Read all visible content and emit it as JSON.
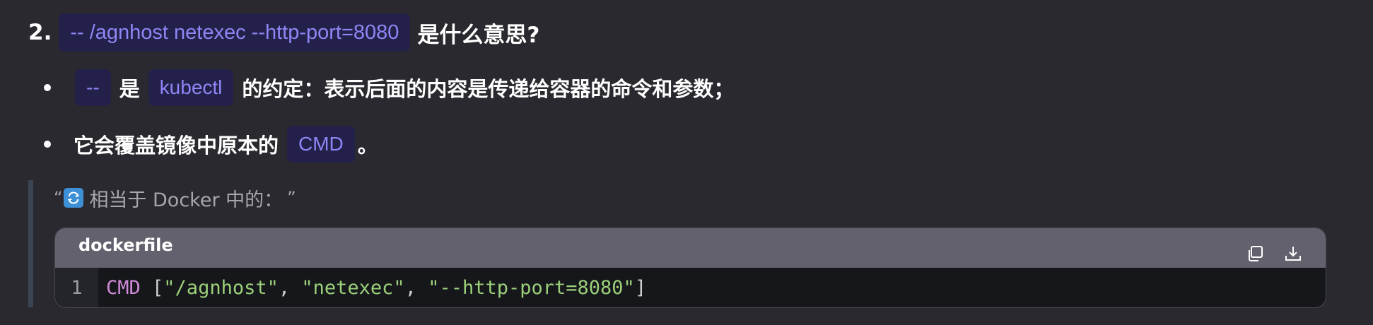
{
  "heading": {
    "number": "2.",
    "code": "-- /agnhost netexec --http-port=8080",
    "tail": "是什么意思?"
  },
  "bullets": [
    {
      "chip1": "--",
      "text1": "是",
      "chip2": "kubectl",
      "text2": "的约定：表示后面的内容是传递给容器的命令和参数；"
    },
    {
      "text1": "它会覆盖镜像中原本的",
      "chip1": "CMD",
      "text2": "。"
    }
  ],
  "quote": {
    "open_mark": "“",
    "icon": "repeat-icon",
    "text": "相当于 Docker 中的：",
    "close_mark": "”"
  },
  "code_block": {
    "language": "dockerfile",
    "copy_icon": "copy-icon",
    "download_icon": "download-icon",
    "line_number": "1",
    "tokens": {
      "keyword": "CMD",
      "open": " [",
      "s1": "\"/agnhost\"",
      "comma1": ", ",
      "s2": "\"netexec\"",
      "comma2": ", ",
      "s3": "\"--http-port=8080\"",
      "close": "]"
    }
  },
  "colors": {
    "background": "#2a292f",
    "chip_bg": "#23214a",
    "chip_text": "#8e86f5",
    "keyword": "#d08ad8",
    "string": "#9bd07a"
  }
}
